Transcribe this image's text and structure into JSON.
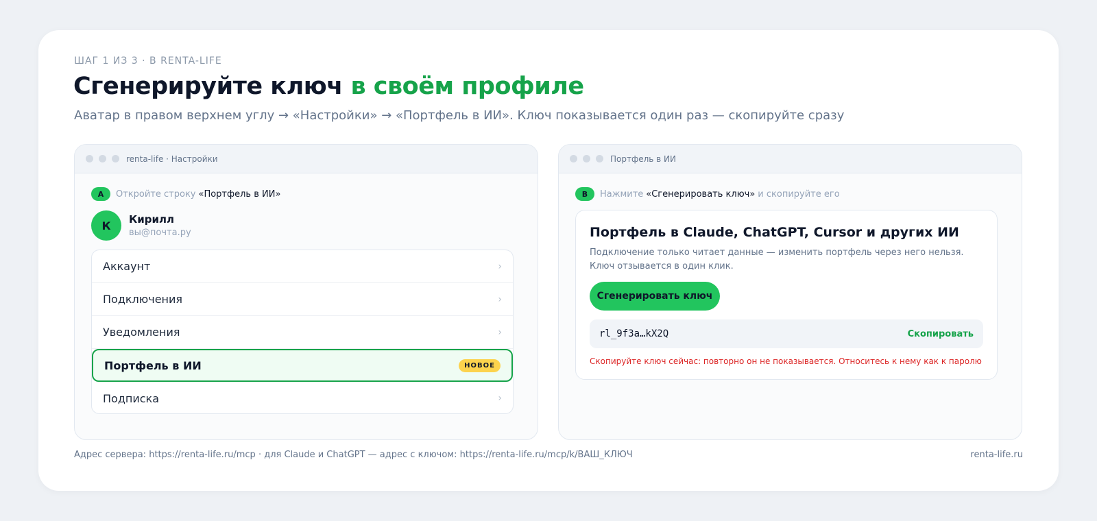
{
  "header": {
    "step": "ШАГ 1 ИЗ 3 · В RENTA-LIFE",
    "title_dark": "Сгенерируйте ключ ",
    "title_green": "в своём профиле",
    "subtitle": "Аватар в правом верхнем углу → «Настройки» → «Портфель в ИИ». Ключ показывается один раз — скопируйте сразу"
  },
  "left_panel": {
    "window_title": "renta-life · Настройки",
    "badge": "A",
    "instruction_prefix": "Откройте строку ",
    "instruction_strong": "«Портфель в ИИ»",
    "user": {
      "avatar_letter": "К",
      "name": "Кирилл",
      "email": "вы@почта.ру"
    },
    "menu": [
      {
        "label": "Аккаунт",
        "chevron": "›"
      },
      {
        "label": "Подключения",
        "chevron": "›"
      },
      {
        "label": "Уведомления",
        "chevron": "›"
      },
      {
        "label": "Портфель в ИИ",
        "badge": "НОВОЕ",
        "active": true
      },
      {
        "label": "Подписка",
        "chevron": "›"
      }
    ]
  },
  "right_panel": {
    "window_title": "Портфель в ИИ",
    "badge": "B",
    "instruction_prefix": "Нажмите ",
    "instruction_strong": "«Сгенерировать ключ»",
    "instruction_suffix": "и скопируйте его",
    "card": {
      "title": "Портфель в Claude, ChatGPT, Cursor и других ИИ",
      "description": "Подключение только читает данные — изменить портфель через него нельзя. Ключ отзывается в один клик.",
      "button_label": "Сгенерировать ключ",
      "key_value": "rl_9f3a…kX2Q",
      "copy_label": "Скопировать",
      "warning": "Скопируйте ключ сейчас: повторно он не показывается. Относитесь к нему как к паролю"
    }
  },
  "footer": {
    "left": "Адрес сервера: https://renta-life.ru/mcp · для Claude и ChatGPT — адрес с ключом: https://renta-life.ru/mcp/k/ВАШ_КЛЮЧ",
    "right": "renta-life.ru"
  },
  "colors": {
    "accent_green": "#22c55e",
    "title_green": "#16a34a",
    "badge_yellow": "#fcd34d",
    "warning_red": "#dc2626"
  }
}
